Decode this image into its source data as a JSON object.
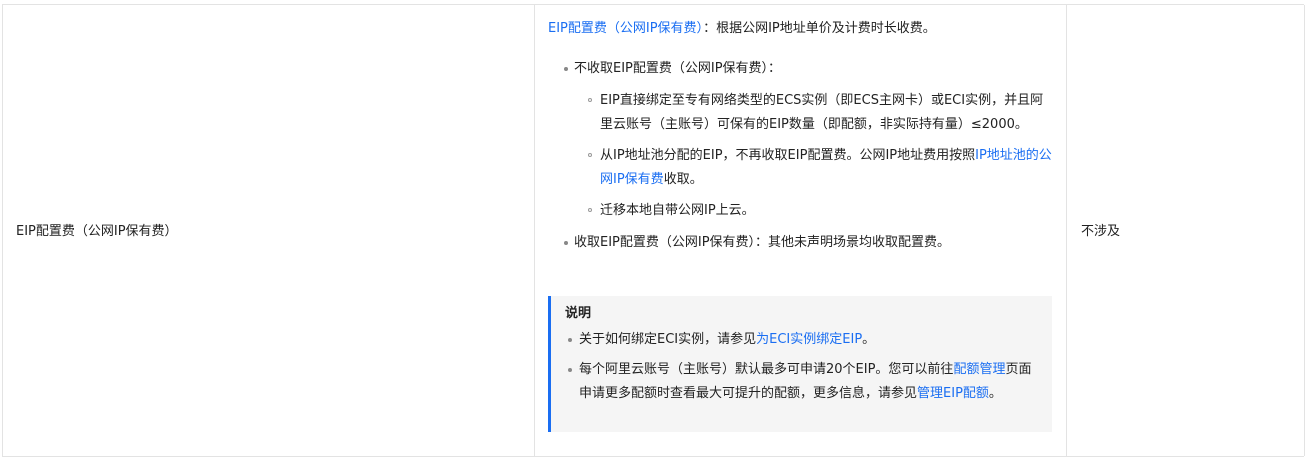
{
  "row": {
    "item_name": "EIP配置费（公网IP保有费）",
    "not_applicable": "不涉及"
  },
  "description": {
    "lead_link": "EIP配置费（公网IP保有费）",
    "lead_text": "：根据公网IP地址单价及计费时长收费。",
    "not_charged": {
      "label": "不收取EIP配置费（公网IP保有费）：",
      "items": [
        {
          "text": "EIP直接绑定至专有网络类型的ECS实例（即ECS主网卡）或ECI实例，并且阿里云账号（主账号）可保有的EIP数量（即配额，非实际持有量）≤2000。"
        },
        {
          "text_before": "从IP地址池分配的EIP，不再收取EIP配置费。公网IP地址费用按照",
          "link": "IP地址池的公网IP保有费",
          "text_after": "收取。"
        },
        {
          "text": "迁移本地自带公网IP上云。"
        }
      ]
    },
    "charged": "收取EIP配置费（公网IP保有费）：其他未声明场景均收取配置费。"
  },
  "note": {
    "title": "说明",
    "items": [
      {
        "text_before": "关于如何绑定ECI实例，请参见",
        "link": "为ECI实例绑定EIP",
        "text_after": "。"
      },
      {
        "text_before": "每个阿里云账号（主账号）默认最多可申请20个EIP。您可以前往",
        "link": "配额管理",
        "text_mid": "页面申请更多配额时查看最大可提升的配额，更多信息，请参见",
        "link2": "管理EIP配额",
        "text_after": "。"
      }
    ]
  },
  "colors": {
    "link": "#1a6ef2",
    "note_bg": "#f5f5f5",
    "note_border": "#1a6ef2",
    "table_border": "#e3e3e3"
  }
}
